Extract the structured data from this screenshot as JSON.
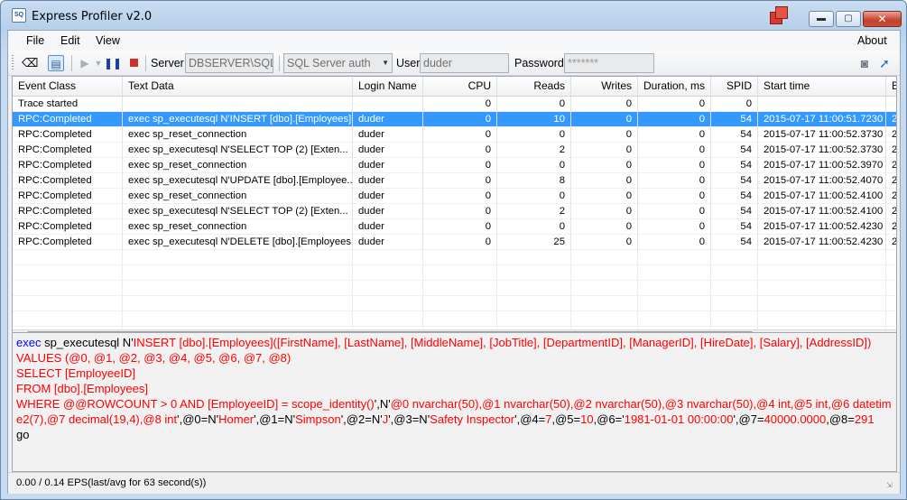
{
  "window": {
    "title": "Express Profiler v2.0",
    "app_icon": "SQ"
  },
  "menu": {
    "file": "File",
    "edit": "Edit",
    "view": "View",
    "about": "About"
  },
  "toolbar": {
    "server_label": "Server",
    "server_value": "DBSERVER\\SQLEX",
    "auth_value": "SQL Server auth",
    "user_label": "User",
    "user_value": "duder",
    "password_label": "Password",
    "password_value": "*******"
  },
  "grid": {
    "columns": [
      "Event Class",
      "Text Data",
      "Login Name",
      "CPU",
      "Reads",
      "Writes",
      "Duration, ms",
      "SPID",
      "Start time",
      "E"
    ],
    "rows": [
      [
        "Trace started",
        "",
        "",
        "0",
        "0",
        "0",
        "0",
        "0",
        "",
        ""
      ],
      [
        "RPC:Completed",
        "exec sp_executesql N'INSERT [dbo].[Employees]...",
        "duder",
        "0",
        "10",
        "0",
        "0",
        "54",
        "2015-07-17 11:00:51.7230",
        "2"
      ],
      [
        "RPC:Completed",
        "exec sp_reset_connection",
        "duder",
        "0",
        "0",
        "0",
        "0",
        "54",
        "2015-07-17 11:00:52.3730",
        "2"
      ],
      [
        "RPC:Completed",
        "exec sp_executesql N'SELECT TOP (2)     [Exten...",
        "duder",
        "0",
        "2",
        "0",
        "0",
        "54",
        "2015-07-17 11:00:52.3730",
        "2"
      ],
      [
        "RPC:Completed",
        "exec sp_reset_connection",
        "duder",
        "0",
        "0",
        "0",
        "0",
        "54",
        "2015-07-17 11:00:52.3970",
        "2"
      ],
      [
        "RPC:Completed",
        "exec sp_executesql N'UPDATE [dbo].[Employee...",
        "duder",
        "0",
        "8",
        "0",
        "0",
        "54",
        "2015-07-17 11:00:52.4070",
        "2"
      ],
      [
        "RPC:Completed",
        "exec sp_reset_connection",
        "duder",
        "0",
        "0",
        "0",
        "0",
        "54",
        "2015-07-17 11:00:52.4100",
        "2"
      ],
      [
        "RPC:Completed",
        "exec sp_executesql N'SELECT TOP (2)     [Exten...",
        "duder",
        "0",
        "2",
        "0",
        "0",
        "54",
        "2015-07-17 11:00:52.4100",
        "2"
      ],
      [
        "RPC:Completed",
        "exec sp_reset_connection",
        "duder",
        "0",
        "0",
        "0",
        "0",
        "54",
        "2015-07-17 11:00:52.4230",
        "2"
      ],
      [
        "RPC:Completed",
        "exec sp_executesql N'DELETE [dbo].[Employees...",
        "duder",
        "0",
        "25",
        "0",
        "0",
        "54",
        "2015-07-17 11:00:52.4230",
        "2"
      ]
    ],
    "selected_row": 1
  },
  "sql": [
    {
      "t": "exec",
      "c": "kw"
    },
    {
      "t": " sp_executesql N'",
      "c": ""
    },
    {
      "t": "INSERT [dbo].[Employees]([FirstName], [LastName], [MiddleName], [JobTitle], [DepartmentID], [ManagerID], [HireDate], [Salary], [AddressID])\nVALUES (@0, @1, @2, @3, @4, @5, @6, @7, @8)\nSELECT [EmployeeID]\nFROM [dbo].[Employees]\nWHERE @@ROWCOUNT > 0 AND [EmployeeID] = scope_identity()",
      "c": "st"
    },
    {
      "t": "',N'",
      "c": ""
    },
    {
      "t": "@0 nvarchar(50),@1 nvarchar(50),@2 nvarchar(50),@3 nvarchar(50),@4 int,@5 int,@6 datetime2(7),@7 decimal(19,4),@8 int",
      "c": "st"
    },
    {
      "t": "',@0=N'",
      "c": ""
    },
    {
      "t": "Homer",
      "c": "st"
    },
    {
      "t": "',@1=N'",
      "c": ""
    },
    {
      "t": "Simpson",
      "c": "st"
    },
    {
      "t": "',@2=N'",
      "c": ""
    },
    {
      "t": "J",
      "c": "st"
    },
    {
      "t": "',@3=N'",
      "c": ""
    },
    {
      "t": "Safety Inspector",
      "c": "st"
    },
    {
      "t": "',@4=",
      "c": ""
    },
    {
      "t": "7",
      "c": "st"
    },
    {
      "t": ",@5=",
      "c": ""
    },
    {
      "t": "10",
      "c": "st"
    },
    {
      "t": ",@6='",
      "c": ""
    },
    {
      "t": "1981-01-01 00:00:00",
      "c": "st"
    },
    {
      "t": "',@7=",
      "c": ""
    },
    {
      "t": "40000.0000",
      "c": "st"
    },
    {
      "t": ",@8=",
      "c": ""
    },
    {
      "t": "291",
      "c": "st"
    },
    {
      "t": "\ngo",
      "c": ""
    }
  ],
  "status": "0.00 / 0.14 EPS(last/avg for 63 second(s))"
}
